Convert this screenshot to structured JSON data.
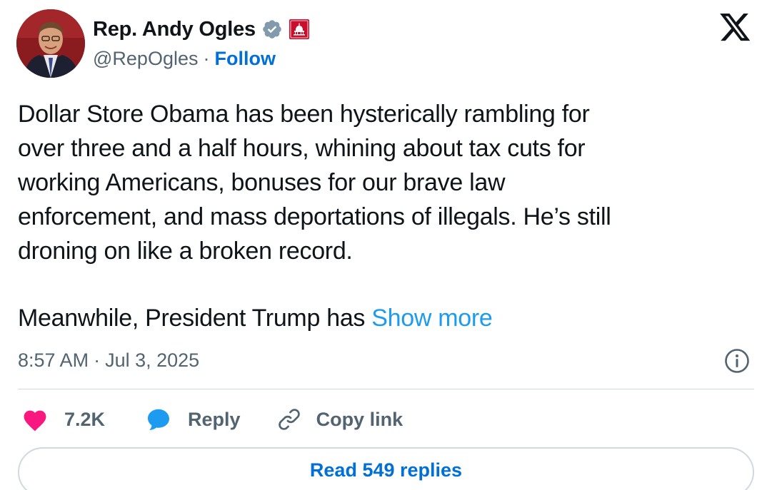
{
  "author": {
    "display_name": "Rep. Andy Ogles",
    "handle": "@RepOgles",
    "separator": "·",
    "follow_label": "Follow",
    "verified_icon": "verified-badge-gray",
    "affiliate_icon": "capitol-building-badge"
  },
  "tweet": {
    "text": "Dollar Store Obama has been hysterically rambling for\nover three and a half hours, whining about tax cuts for\nworking Americans, bonuses for our brave law\nenforcement, and mass deportations of illegals. He’s still\ndroning on like a broken record.",
    "text2": "Meanwhile, President Trump has ",
    "show_more": "Show more",
    "time": "8:57 AM",
    "separator": "·",
    "date": "Jul 3, 2025"
  },
  "actions": {
    "like_count": "7.2K",
    "reply_label": "Reply",
    "copy_link_label": "Copy link",
    "read_replies_label": "Read 549 replies"
  },
  "colors": {
    "text": "#0f1419",
    "muted": "#536471",
    "link": "#006fd6",
    "show_more": "#1d9bf0",
    "like": "#f91880",
    "reply": "#1d9bf0",
    "border": "#cfd9de"
  }
}
